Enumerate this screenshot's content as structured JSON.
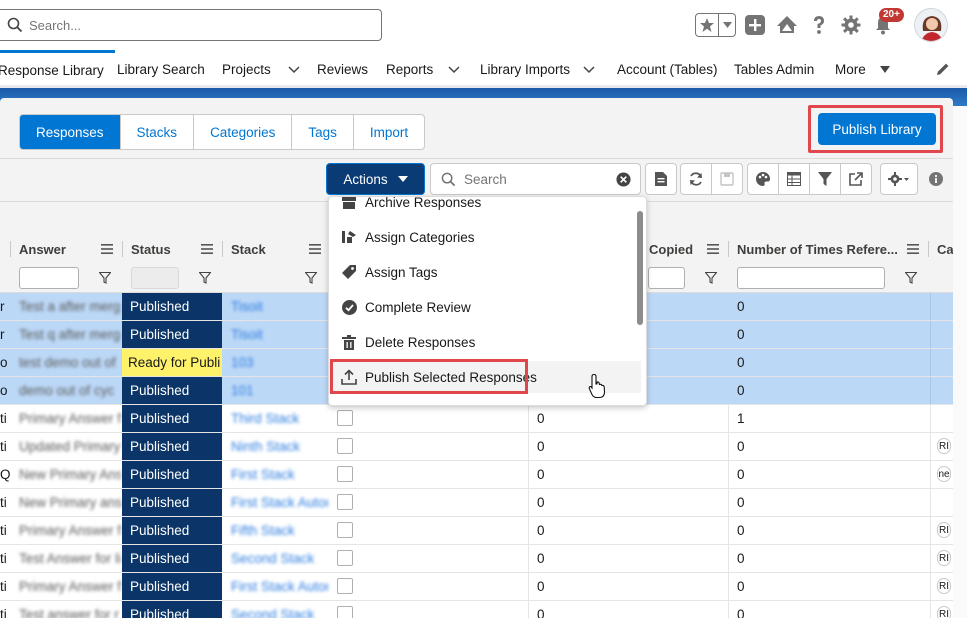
{
  "header": {
    "search_placeholder": "Search...",
    "notification_count": "20+"
  },
  "nav": {
    "items": [
      {
        "label": "Response Library",
        "active": true
      },
      {
        "label": "Library Search"
      },
      {
        "label": "Projects",
        "dropdown": true
      },
      {
        "label": "Reviews"
      },
      {
        "label": "Reports",
        "dropdown": true
      },
      {
        "label": "Library Imports",
        "dropdown": true
      },
      {
        "label": "Account (Tables)"
      },
      {
        "label": "Tables Admin"
      },
      {
        "label": "More",
        "dropdown": true
      }
    ]
  },
  "tabs": [
    {
      "label": "Responses",
      "active": true
    },
    {
      "label": "Stacks"
    },
    {
      "label": "Categories"
    },
    {
      "label": "Tags"
    },
    {
      "label": "Import"
    }
  ],
  "publish_library_label": "Publish Library",
  "toolbar": {
    "actions_label": "Actions",
    "search_placeholder": "Search"
  },
  "table": {
    "columns": [
      "Answer",
      "Status",
      "Stack",
      "Copied",
      "Number of Times Refere...",
      "Cat"
    ],
    "rows": [
      {
        "q": "r",
        "answer": "Test a after merg",
        "status": "Published",
        "stack": "Tisoit",
        "copied": "",
        "refs": "0",
        "tag": "",
        "selected": true
      },
      {
        "q": "r",
        "answer": "Test q after merg",
        "status": "Published",
        "stack": "Tisoit",
        "copied": "",
        "refs": "0",
        "tag": "",
        "selected": true
      },
      {
        "q": "o",
        "answer": "test demo out of",
        "status": "Ready for Publi",
        "stack": "103",
        "copied": "",
        "refs": "0",
        "tag": "",
        "selected": true
      },
      {
        "q": "o",
        "answer": "demo out of cyc",
        "status": "Published",
        "stack": "101",
        "copied": "",
        "refs": "0",
        "tag": "",
        "selected": true
      },
      {
        "q": "ti",
        "answer": "Primary Answer f",
        "status": "Published",
        "stack": "Third Stack",
        "copied": "0",
        "refs": "1",
        "tag": "",
        "selected": false
      },
      {
        "q": "ti",
        "answer": "Updated Primary",
        "status": "Published",
        "stack": "Ninth Stack",
        "copied": "0",
        "refs": "0",
        "tag": "RI",
        "selected": false
      },
      {
        "q": "Q",
        "answer": "New Primary Ans",
        "status": "Published",
        "stack": "First Stack",
        "copied": "0",
        "refs": "0",
        "tag": "ne",
        "selected": false
      },
      {
        "q": "ti",
        "answer": "New Primary ans",
        "status": "Published",
        "stack": "First Stack Autor",
        "copied": "0",
        "refs": "0",
        "tag": "",
        "selected": false
      },
      {
        "q": "ti",
        "answer": "Primary Answer f",
        "status": "Published",
        "stack": "Fifth Stack",
        "copied": "0",
        "refs": "0",
        "tag": "RI",
        "selected": false
      },
      {
        "q": "ti",
        "answer": "Test Answer for li",
        "status": "Published",
        "stack": "Second Stack",
        "copied": "0",
        "refs": "0",
        "tag": "RI",
        "selected": false
      },
      {
        "q": "ti",
        "answer": "Primary Answer f",
        "status": "Published",
        "stack": "First Stack Autor",
        "copied": "0",
        "refs": "0",
        "tag": "RI",
        "selected": false
      },
      {
        "q": "ti",
        "answer": "Test answer for r",
        "status": "Published",
        "stack": "Second Stack",
        "copied": "0",
        "refs": "0",
        "tag": "RI",
        "selected": false
      }
    ]
  },
  "actions_menu": {
    "items": [
      {
        "label": "Archive Responses",
        "icon": "archive-icon"
      },
      {
        "label": "Assign Categories",
        "icon": "category-icon"
      },
      {
        "label": "Assign Tags",
        "icon": "tag-icon"
      },
      {
        "label": "Complete Review",
        "icon": "check-circle-icon"
      },
      {
        "label": "Delete Responses",
        "icon": "trash-icon"
      },
      {
        "label": "Publish Selected Responses",
        "icon": "upload-icon",
        "hover": true
      }
    ]
  },
  "colors": {
    "brand": "#0176d3",
    "published": "#0b3568",
    "ready": "#fff26b",
    "selected_row": "#bcd8f7",
    "highlight": "#e0474c"
  }
}
